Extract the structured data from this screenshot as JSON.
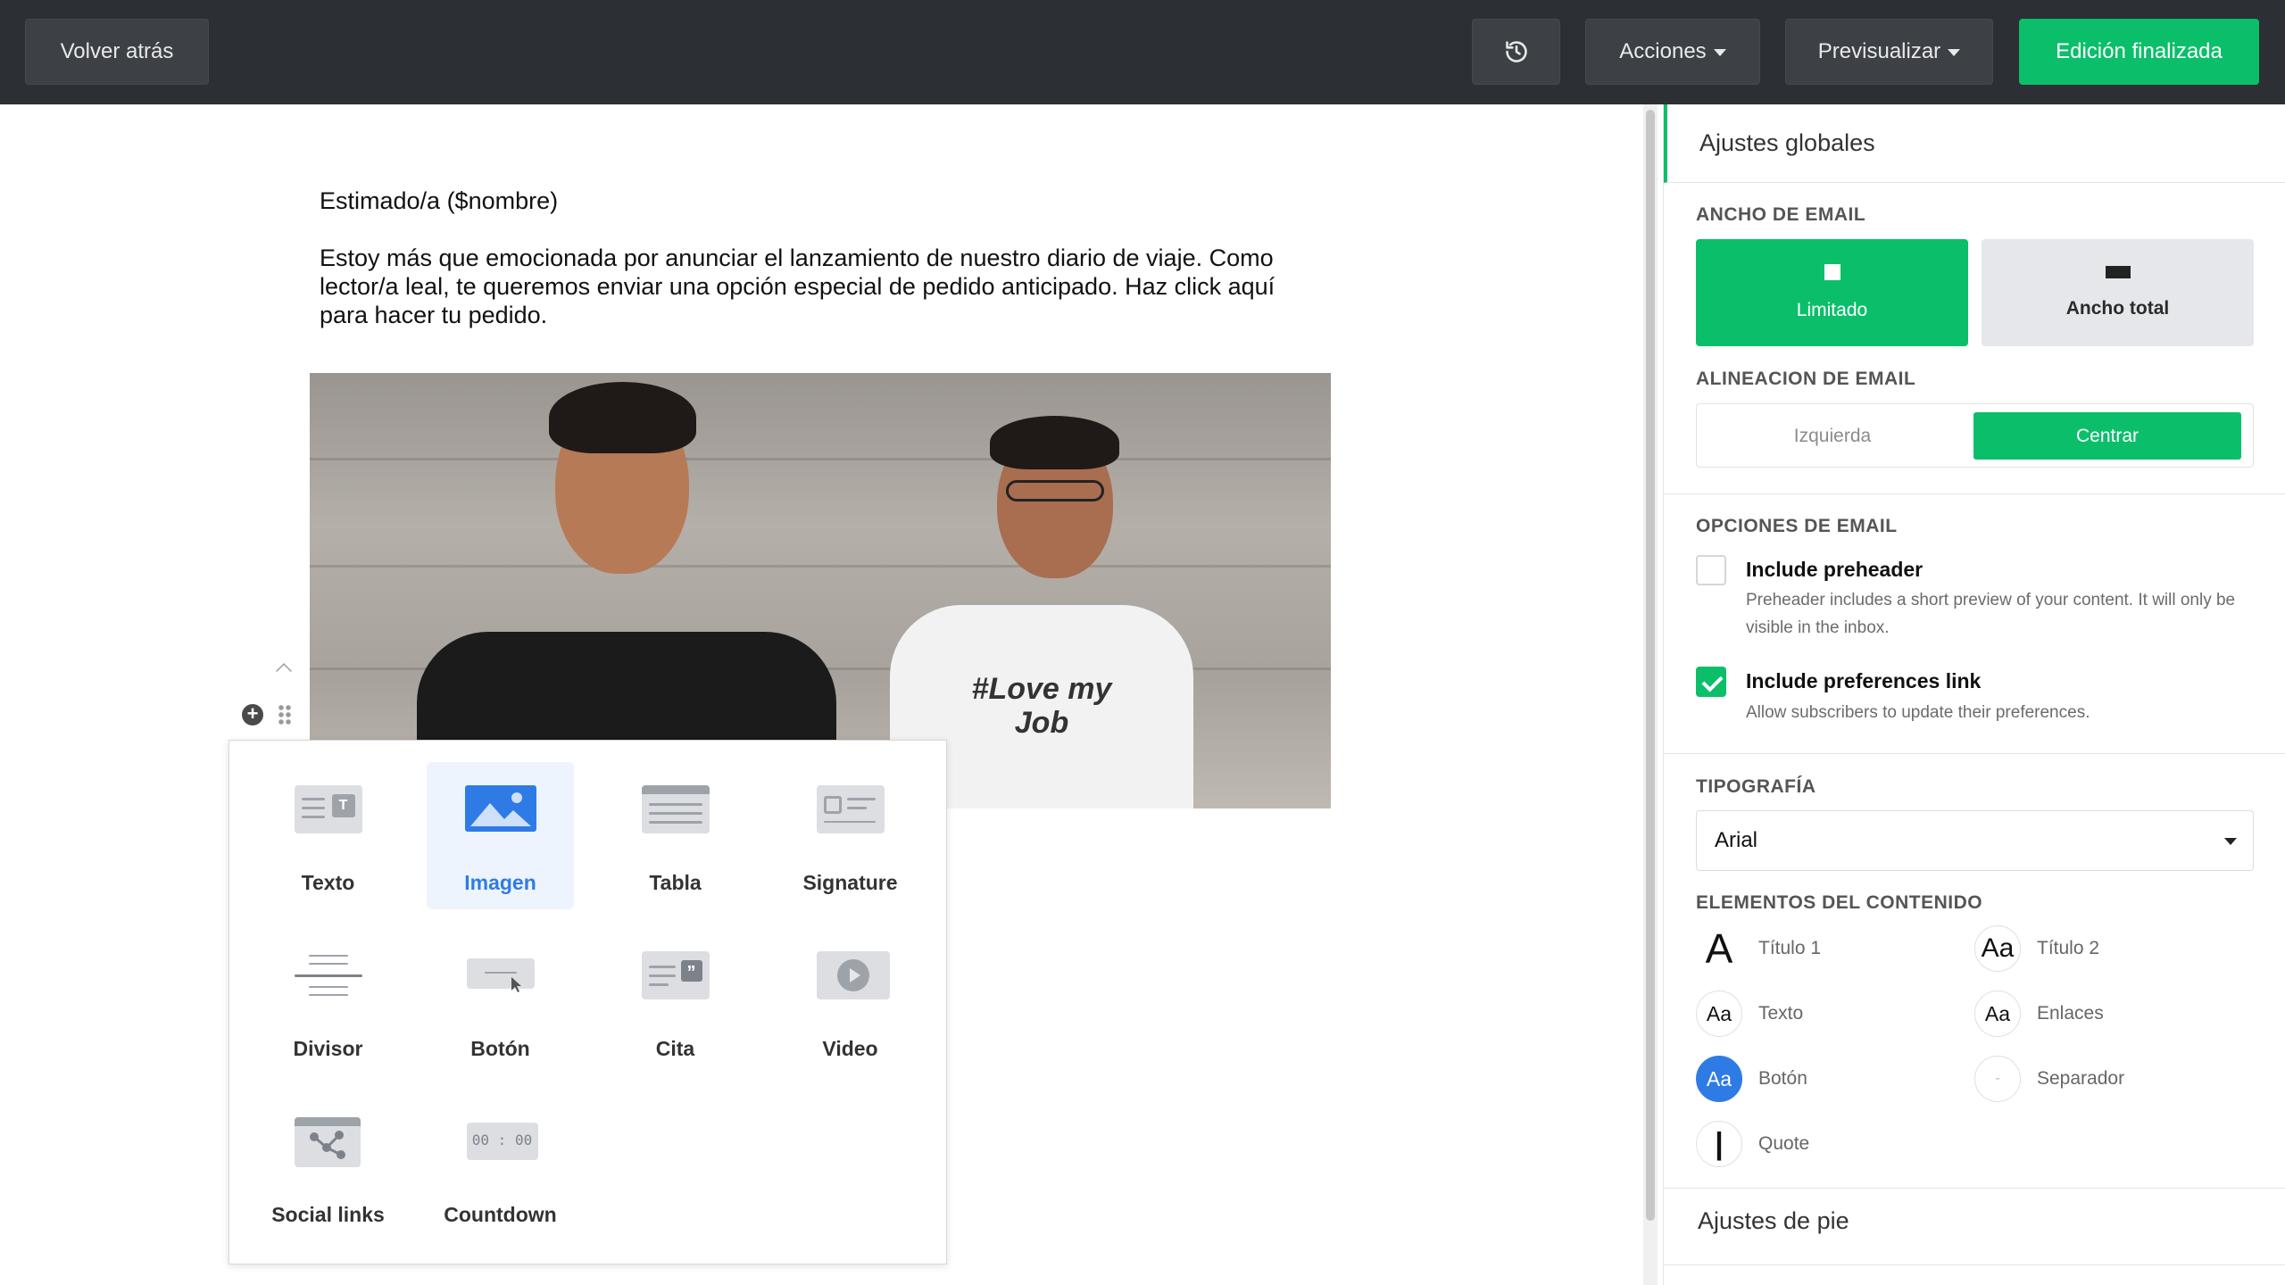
{
  "topbar": {
    "back_label": "Volver atrás",
    "history_icon": "history-icon",
    "actions_label": "Acciones",
    "preview_label": "Previsualizar",
    "finish_label": "Edición finalizada"
  },
  "email": {
    "greeting": "Estimado/a ($nombre)",
    "body": "Estoy más que emocionada por anunciar el lanzamiento de nuestro diario de viaje. Como lector/a leal, te queremos enviar una opción especial de pedido anticipado. Haz click aquí para hacer tu pedido.",
    "shirt_print": "#Love my Job"
  },
  "block_picker": {
    "items": [
      {
        "label": "Texto",
        "icon": "text-block-icon"
      },
      {
        "label": "Imagen",
        "icon": "image-block-icon",
        "active": true
      },
      {
        "label": "Tabla",
        "icon": "table-block-icon"
      },
      {
        "label": "Signature",
        "icon": "signature-block-icon"
      },
      {
        "label": "Divisor",
        "icon": "divider-block-icon"
      },
      {
        "label": "Botón",
        "icon": "button-block-icon"
      },
      {
        "label": "Cita",
        "icon": "quote-block-icon"
      },
      {
        "label": "Video",
        "icon": "video-block-icon"
      },
      {
        "label": "Social links",
        "icon": "social-links-block-icon"
      },
      {
        "label": "Countdown",
        "icon": "countdown-block-icon"
      }
    ],
    "countdown_glyph": "00 : 00"
  },
  "panel": {
    "title": "Ajustes globales",
    "email_width": {
      "label": "ANCHO DE EMAIL",
      "limited": "Limitado",
      "full": "Ancho total",
      "selected": "Limitado"
    },
    "email_alignment": {
      "label": "ALINEACION DE EMAIL",
      "left": "Izquierda",
      "center": "Centrar",
      "selected": "Centrar"
    },
    "email_options": {
      "label": "OPCIONES DE EMAIL",
      "preheader_title": "Include preheader",
      "preheader_desc": "Preheader includes a short preview of your content. It will only be visible in the inbox.",
      "preheader_checked": false,
      "prefs_title": "Include preferences link",
      "prefs_desc": "Allow subscribers to update their preferences.",
      "prefs_checked": true
    },
    "typography": {
      "label": "TIPOGRAFÍA",
      "font": "Arial"
    },
    "content_elements": {
      "label": "ELEMENTOS DEL CONTENIDO",
      "items": [
        {
          "glyph": "A",
          "label": "Título 1"
        },
        {
          "glyph": "Aa",
          "label": "Título 2"
        },
        {
          "glyph": "Aa",
          "label": "Texto"
        },
        {
          "glyph": "Aa",
          "label": "Enlaces"
        },
        {
          "glyph": "Aa",
          "label": "Botón"
        },
        {
          "glyph": "-",
          "label": "Separador"
        },
        {
          "glyph": "|",
          "label": "Quote"
        }
      ]
    },
    "footer_settings": "Ajustes de pie"
  },
  "colors": {
    "accent": "#0bbf6a",
    "topbar": "#2c2f33",
    "picker_active": "#2f7be6",
    "button_swatch": "#2f7be6"
  }
}
